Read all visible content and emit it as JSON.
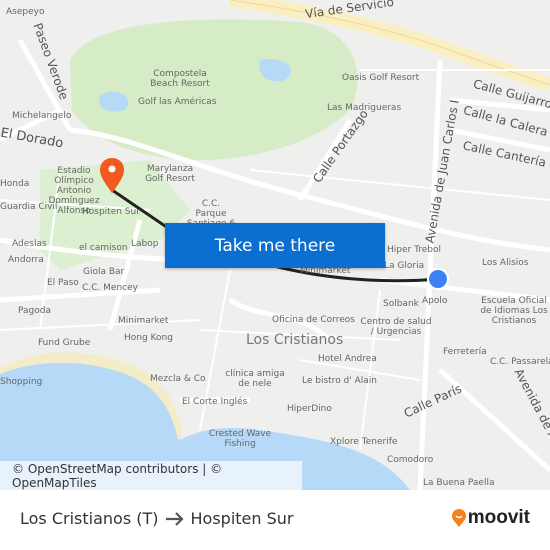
{
  "map": {
    "labels": [
      "Asepeyo",
      "Vía de Servicio",
      "Paseo Verode",
      "Compostela Beach Resort",
      "Golf las Américas",
      "Oasis Golf Resort",
      "Calle Guijarro",
      "Calle la Calera",
      "Las Madrigueras",
      "Calle Portazgo",
      "Avenida de Juan Carlos I",
      "Calle Cantería",
      "Michelangelo",
      "El Dorado",
      "Estadio Olímpico Antonio Domínguez Alfonso",
      "Marylanza Golf Resort",
      "Honda",
      "Guardia Civil",
      "Hospiten Sur",
      "C.C. Parque Santiago 6",
      "Adeslas",
      "el camison",
      "Labop",
      "Andorra",
      "Giola Bar",
      "El Paso",
      "C.C. Mencey",
      "Hiper Trebol",
      "La Gloria",
      "Minimarket",
      "Los Alisios",
      "Apolo",
      "Solbank",
      "Escuela Oficial de Idiomas Los Cristianos",
      "Pagoda",
      "Minimarket",
      "Oficina de Correos",
      "Centro de salud / Urgencias",
      "Fund Grube",
      "Hong Kong",
      "Los Cristianos",
      "Hotel Andrea",
      "Ferretería",
      "C.C. Passarela",
      "Shopping",
      "Mezcla & Co",
      "clínica amiga de nele",
      "Le bistro d' Alain",
      "Calle París",
      "El Corte Inglés",
      "HiperDino",
      "Avenida de Amsterdam",
      "Crested Wave Fishing",
      "Xplore Tenerife",
      "Comodoro",
      "La Buena Paella"
    ],
    "cta_label": "Take me there",
    "attribution": "© OpenStreetMap contributors | © OpenMapTiles",
    "origin_icon": "location-dot-icon",
    "destination_icon": "map-pin-icon",
    "colors": {
      "route": "#222222",
      "button": "#0a6fd1",
      "pin": "#f25a1f",
      "origin": "#3b82f6",
      "water": "#b5d9f6",
      "park": "#d6ecc6"
    }
  },
  "footer": {
    "origin": "Los Cristianos (T)",
    "arrow_icon": "arrow-right-icon",
    "destination": "Hospiten Sur",
    "brand": "moovit"
  }
}
